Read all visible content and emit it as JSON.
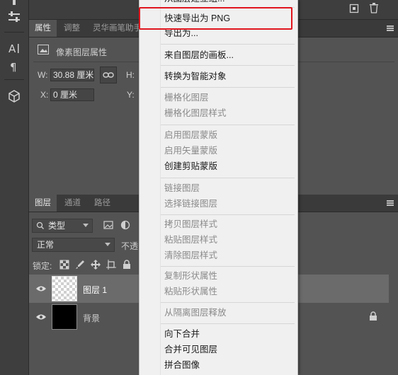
{
  "properties_panel": {
    "tabs": [
      "属性",
      "调整",
      "灵华画笔助手"
    ],
    "header_label": "像素图层属性",
    "w_label": "W:",
    "w_value": "30.88 厘米",
    "h_label": "H:",
    "x_label": "X:",
    "x_value": "0 厘米",
    "y_label": "Y:"
  },
  "layers_panel": {
    "tabs": [
      "图层",
      "通道",
      "路径"
    ],
    "filter_label": "类型",
    "blend_mode": "正常",
    "opacity_label": "不透",
    "lock_label": "锁定:",
    "layers": [
      {
        "name": "图层 1",
        "thumbnail": "transparent",
        "selected": true
      },
      {
        "name": "背景",
        "thumbnail": "black",
        "locked": true
      }
    ]
  },
  "context_menu": {
    "top_partial": "从图层建立组...",
    "items": [
      {
        "label": "快速导出为 PNG",
        "enabled": true,
        "highlighted": true
      },
      {
        "label": "导出为...",
        "enabled": true
      },
      {
        "label": "来自图层的画板...",
        "enabled": true
      },
      {
        "label": "转换为智能对象",
        "enabled": true
      },
      {
        "label": "栅格化图层",
        "enabled": false
      },
      {
        "label": "栅格化图层样式",
        "enabled": false
      },
      {
        "label": "启用图层蒙版",
        "enabled": false
      },
      {
        "label": "启用矢量蒙版",
        "enabled": false
      },
      {
        "label": "创建剪贴蒙版",
        "enabled": true
      },
      {
        "label": "链接图层",
        "enabled": false
      },
      {
        "label": "选择链接图层",
        "enabled": false
      },
      {
        "label": "拷贝图层样式",
        "enabled": false
      },
      {
        "label": "粘贴图层样式",
        "enabled": false
      },
      {
        "label": "清除图层样式",
        "enabled": false
      },
      {
        "label": "复制形状属性",
        "enabled": false
      },
      {
        "label": "粘贴形状属性",
        "enabled": false
      },
      {
        "label": "从隔离图层释放",
        "enabled": false
      },
      {
        "label": "向下合并",
        "enabled": true
      },
      {
        "label": "合并可见图层",
        "enabled": true
      },
      {
        "label": "拼合图像",
        "enabled": true
      }
    ]
  },
  "colors": {
    "highlight_border": "#e0151d",
    "menu_bg": "#f0f0f0",
    "panel_bg": "#535353"
  }
}
